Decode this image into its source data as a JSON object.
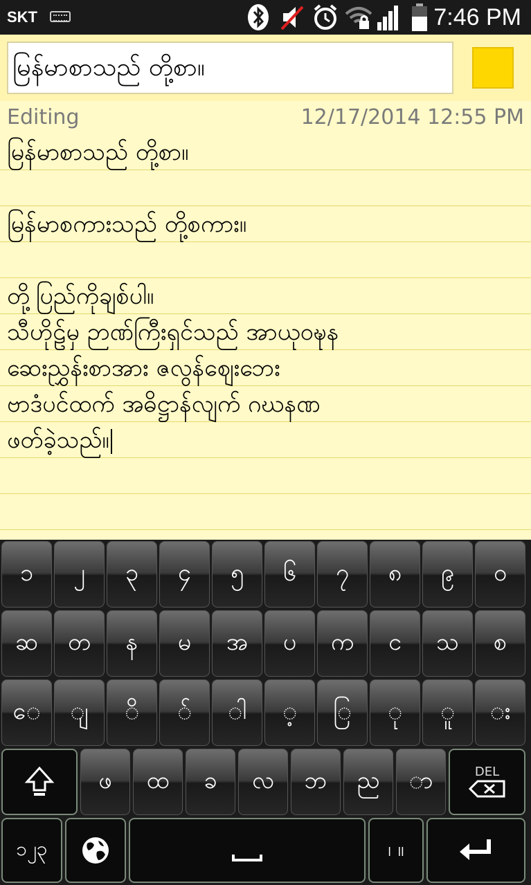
{
  "status_bar": {
    "carrier": "SKT",
    "time": "7:46 PM",
    "icons": [
      "keyboard-indicator-icon",
      "bluetooth-icon",
      "mute-icon",
      "alarm-icon",
      "wifi-icon",
      "signal-icon",
      "battery-icon"
    ]
  },
  "title": {
    "value": "မြန်မာစာသည် တို့စာ။"
  },
  "color_accent": "#ffd700",
  "info": {
    "mode": "Editing",
    "datetime": "12/17/2014 12:55 PM"
  },
  "note": {
    "lines": [
      "မြန်မာစာသည် တို့စာ။",
      "",
      "မြန်မာစကားသည် တို့စကား။",
      "",
      "တို့ပြည်ကိုချစ်ပါ။",
      "သီဟိုဠ်မှ ဉာဏ်ကြီးရှင်သည် အာယုဝဍ္ဎနဆေးညွှန်းစာအား",
      "ဆေးညွှန်းစာအား ဇလွန်ဈေးဘေး",
      "ဗာဒံပင်ထက် အဓိဋ္ဌာန်လျက် ဂဃနဏ",
      "ဖတ်ခဲ့သည်။"
    ]
  },
  "keyboard": {
    "row1": [
      "၁",
      "၂",
      "၃",
      "၄",
      "၅",
      "၆",
      "၇",
      "၈",
      "၉",
      "၀"
    ],
    "row2": [
      "ဆ",
      "တ",
      "န",
      "မ",
      "အ",
      "ပ",
      "က",
      "င",
      "သ",
      "စ"
    ],
    "row3": [
      "ေ",
      "ျ",
      "ိ",
      "်",
      "ါ",
      "့",
      "ြ",
      "ု",
      "ူ",
      "း"
    ],
    "row4": [
      "ဖ",
      "ထ",
      "ခ",
      "လ",
      "ဘ",
      "ည",
      "ာ"
    ],
    "del_label": "DEL",
    "numeric_label": "၁၂၃",
    "punct_label": "၊ ။"
  }
}
